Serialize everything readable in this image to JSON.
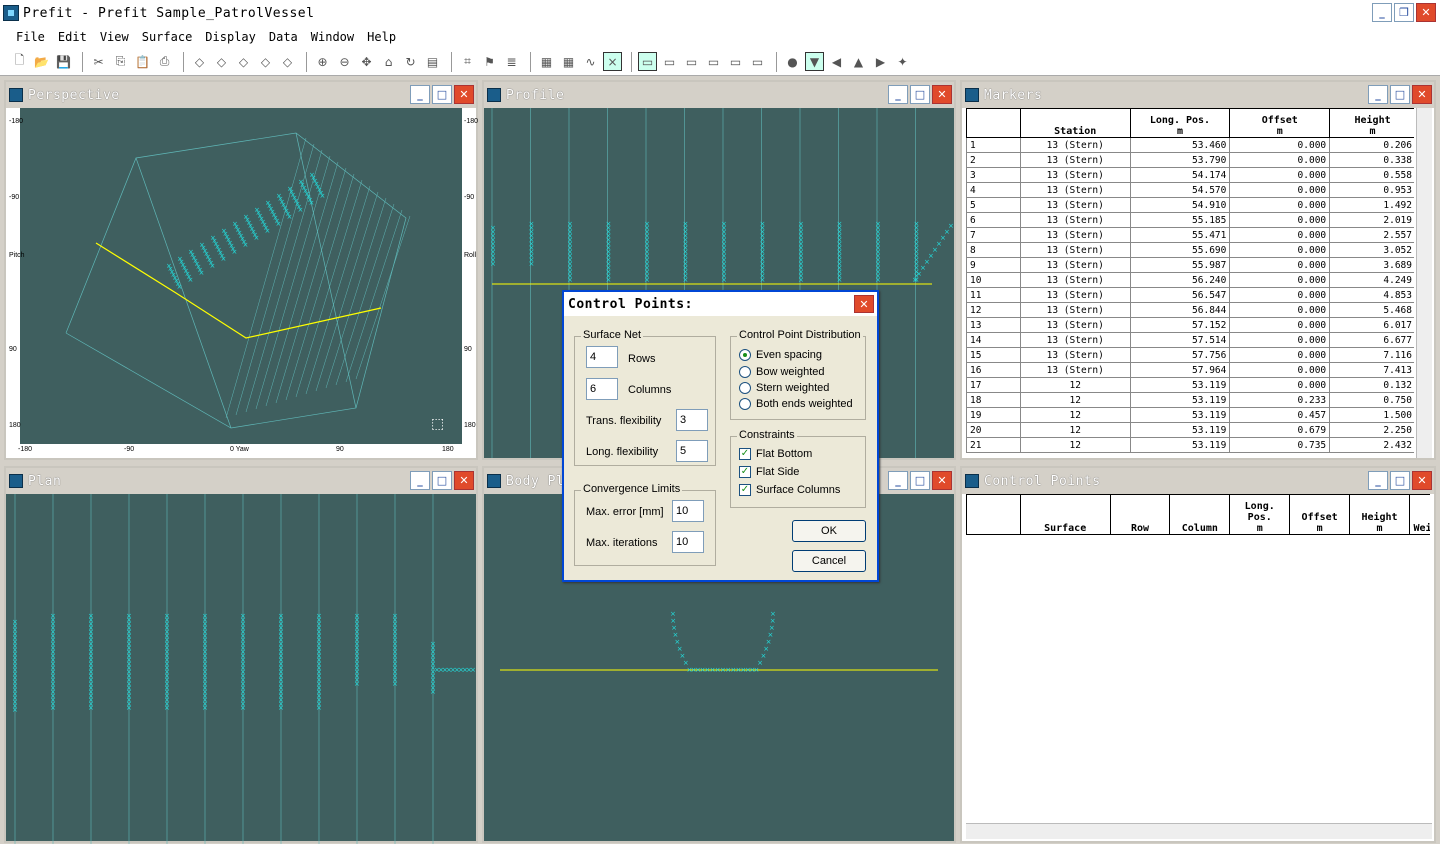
{
  "app": {
    "title": "Prefit - Prefit Sample_PatrolVessel"
  },
  "menu": [
    "File",
    "Edit",
    "View",
    "Surface",
    "Display",
    "Data",
    "Window",
    "Help"
  ],
  "panes": {
    "perspective": "Perspective",
    "profile": "Profile",
    "markers": "Markers",
    "plan": "Plan",
    "body_plan": "Body Pl",
    "control_points": "Control Points"
  },
  "perspective_ticks": {
    "left": [
      "-180",
      "-90",
      "Pitch",
      "90",
      "180"
    ],
    "bottom": [
      "-180",
      "-90",
      "0 Yaw",
      "90",
      "180"
    ],
    "right": [
      "-180",
      "-90",
      "Roll",
      "90",
      "180"
    ]
  },
  "markers_table": {
    "headers": [
      " ",
      "Station",
      "Long. Pos.",
      "Offset",
      "Height"
    ],
    "units": [
      "",
      "",
      "m",
      "m",
      "m"
    ],
    "rows": [
      [
        "1",
        "13 (Stern)",
        "53.460",
        "0.000",
        "0.206"
      ],
      [
        "2",
        "13 (Stern)",
        "53.790",
        "0.000",
        "0.338"
      ],
      [
        "3",
        "13 (Stern)",
        "54.174",
        "0.000",
        "0.558"
      ],
      [
        "4",
        "13 (Stern)",
        "54.570",
        "0.000",
        "0.953"
      ],
      [
        "5",
        "13 (Stern)",
        "54.910",
        "0.000",
        "1.492"
      ],
      [
        "6",
        "13 (Stern)",
        "55.185",
        "0.000",
        "2.019"
      ],
      [
        "7",
        "13 (Stern)",
        "55.471",
        "0.000",
        "2.557"
      ],
      [
        "8",
        "13 (Stern)",
        "55.690",
        "0.000",
        "3.052"
      ],
      [
        "9",
        "13 (Stern)",
        "55.987",
        "0.000",
        "3.689"
      ],
      [
        "10",
        "13 (Stern)",
        "56.240",
        "0.000",
        "4.249"
      ],
      [
        "11",
        "13 (Stern)",
        "56.547",
        "0.000",
        "4.853"
      ],
      [
        "12",
        "13 (Stern)",
        "56.844",
        "0.000",
        "5.468"
      ],
      [
        "13",
        "13 (Stern)",
        "57.152",
        "0.000",
        "6.017"
      ],
      [
        "14",
        "13 (Stern)",
        "57.514",
        "0.000",
        "6.677"
      ],
      [
        "15",
        "13 (Stern)",
        "57.756",
        "0.000",
        "7.116"
      ],
      [
        "16",
        "13 (Stern)",
        "57.964",
        "0.000",
        "7.413"
      ],
      [
        "17",
        "12",
        "53.119",
        "0.000",
        "0.132"
      ],
      [
        "18",
        "12",
        "53.119",
        "0.233",
        "0.750"
      ],
      [
        "19",
        "12",
        "53.119",
        "0.457",
        "1.500"
      ],
      [
        "20",
        "12",
        "53.119",
        "0.679",
        "2.250"
      ],
      [
        "21",
        "12",
        "53.119",
        "0.735",
        "2.432"
      ]
    ]
  },
  "cp_table": {
    "headers": [
      " ",
      "Surface",
      "Row",
      "Column",
      "Long. Pos.",
      "Offset",
      "Height",
      "Wei"
    ],
    "units": [
      "",
      "",
      "",
      "",
      "m",
      "m",
      "m",
      ""
    ]
  },
  "dialog": {
    "title": "Control Points:",
    "surface_net": "Surface Net",
    "rows_value": "4",
    "rows_label": "Rows",
    "cols_value": "6",
    "cols_label": "Columns",
    "trans_label": "Trans. flexibility",
    "trans_value": "3",
    "long_label": "Long. flexibility",
    "long_value": "5",
    "conv_label": "Convergence Limits",
    "maxerr_label": "Max. error [mm]",
    "maxerr_value": "10",
    "maxit_label": "Max. iterations",
    "maxit_value": "10",
    "dist_label": "Control Point Distribution",
    "dist_options": [
      "Even spacing",
      "Bow weighted",
      "Stern weighted",
      "Both ends weighted"
    ],
    "constraints_label": "Constraints",
    "constraints": [
      "Flat Bottom",
      "Flat Side",
      "Surface Columns"
    ],
    "ok": "OK",
    "cancel": "Cancel"
  },
  "colors": {
    "pane_bg": "#3f5f5f",
    "marker": "#22e0e0",
    "line": "#e0e000"
  }
}
